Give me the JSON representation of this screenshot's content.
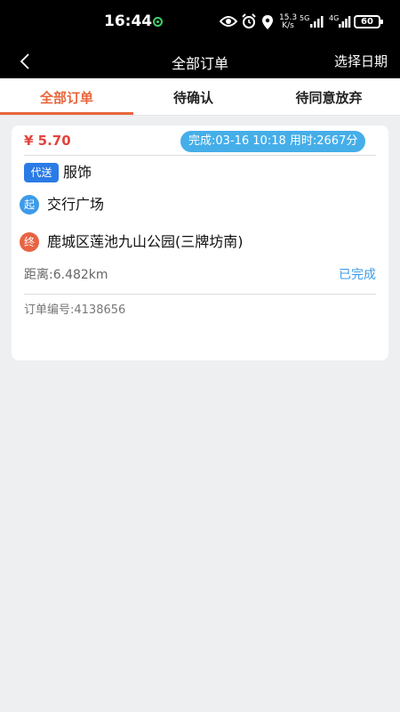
{
  "statusbar": {
    "time": "16:44",
    "net_speed_value": "15.3",
    "net_speed_unit": "K/s",
    "signal1": "5G",
    "signal2": "4G",
    "battery": "60"
  },
  "navbar": {
    "title": "全部订单",
    "right_action": "选择日期"
  },
  "tabs": [
    {
      "label": "全部订单",
      "active": true
    },
    {
      "label": "待确认",
      "active": false
    },
    {
      "label": "待同意放弃",
      "active": false
    }
  ],
  "order": {
    "price": "¥ 5.70",
    "time_badge": "完成:03-16 10:18 用时:2667分",
    "type_badge": "代送",
    "goods": "服饰",
    "start_label": "起",
    "start_address": "交行广场",
    "end_label": "终",
    "end_address": "鹿城区莲池九山公园(三牌坊南)",
    "distance": "距离:6.482km",
    "status": "已完成",
    "order_number": "订单编号:4138656"
  },
  "colors": {
    "accent": "#e8663c",
    "price": "#e5433e",
    "blue": "#45aee9",
    "type_badge": "#2b7be6"
  }
}
